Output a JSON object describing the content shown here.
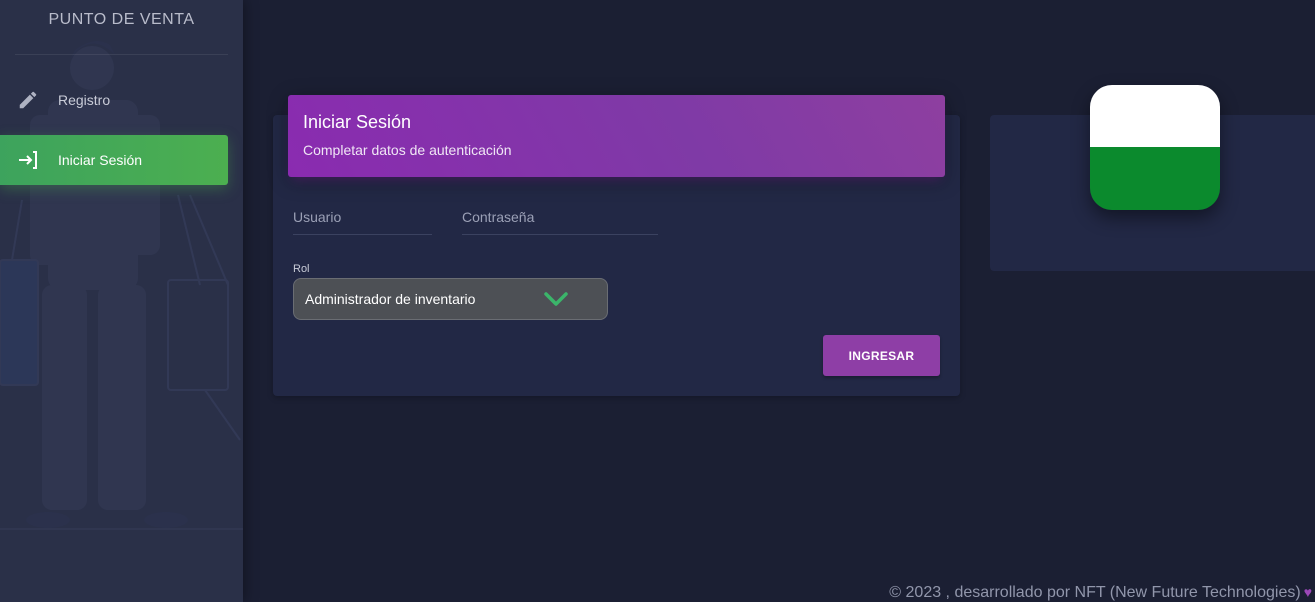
{
  "sidebar": {
    "brand": "PUNTO DE VENTA",
    "items": [
      {
        "label": "Registro",
        "icon": "pencil-icon",
        "active": false
      },
      {
        "label": "Iniciar Sesión",
        "icon": "login-icon",
        "active": true
      }
    ]
  },
  "login": {
    "title": "Iniciar Sesión",
    "subtitle": "Completar datos de autenticación",
    "username_placeholder": "Usuario",
    "password_placeholder": "Contraseña",
    "role_label": "Rol",
    "role_value": "Administrador de inventario",
    "submit_label": "INGRESAR"
  },
  "logo": {
    "colors": [
      "#ffffff",
      "#0b8a2d"
    ]
  },
  "footer": {
    "text": "© 2023 , desarrollado por NFT (New Future Technologies)",
    "heart": "♥"
  },
  "colors": {
    "accent_purple": "#8e3ea6",
    "active_green": "#4caf50",
    "background": "#1b1f33"
  }
}
